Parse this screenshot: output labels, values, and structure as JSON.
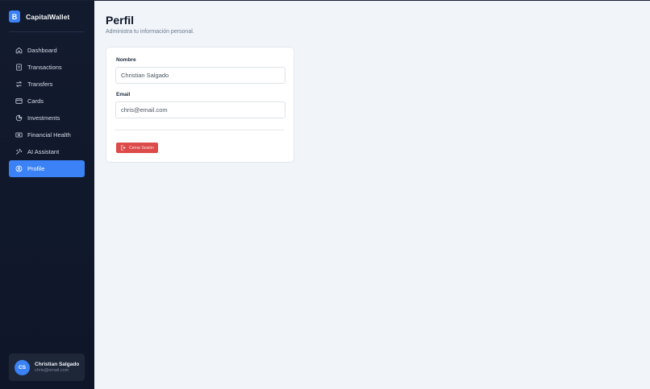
{
  "brand": {
    "logo_letter": "B",
    "name": "CapitalWallet"
  },
  "nav": {
    "items": [
      {
        "label": "Dashboard",
        "icon": "home-icon"
      },
      {
        "label": "Transactions",
        "icon": "receipt-icon"
      },
      {
        "label": "Transfers",
        "icon": "arrows-swap-icon"
      },
      {
        "label": "Cards",
        "icon": "credit-card-icon"
      },
      {
        "label": "Investments",
        "icon": "pie-chart-icon"
      },
      {
        "label": "Financial Health",
        "icon": "banknote-icon"
      },
      {
        "label": "AI Assistant",
        "icon": "sparkles-icon"
      },
      {
        "label": "Profile",
        "icon": "user-circle-icon",
        "active": true
      }
    ]
  },
  "user": {
    "initials": "CS",
    "name": "Christian Salgado",
    "email": "chris@email.com"
  },
  "page": {
    "title": "Perfil",
    "subtitle": "Administra tu información personal."
  },
  "form": {
    "name_label": "Nombre",
    "name_value": "Christian Salgado",
    "email_label": "Email",
    "email_value": "chris@email.com"
  },
  "logout": {
    "label": "Cerrar Sesión",
    "icon": "logout-icon"
  },
  "colors": {
    "accent": "#3b82f6",
    "sidebar_bg": "#121a2e",
    "danger": "#dc4a4a",
    "page_bg": "#f1f4f9"
  }
}
